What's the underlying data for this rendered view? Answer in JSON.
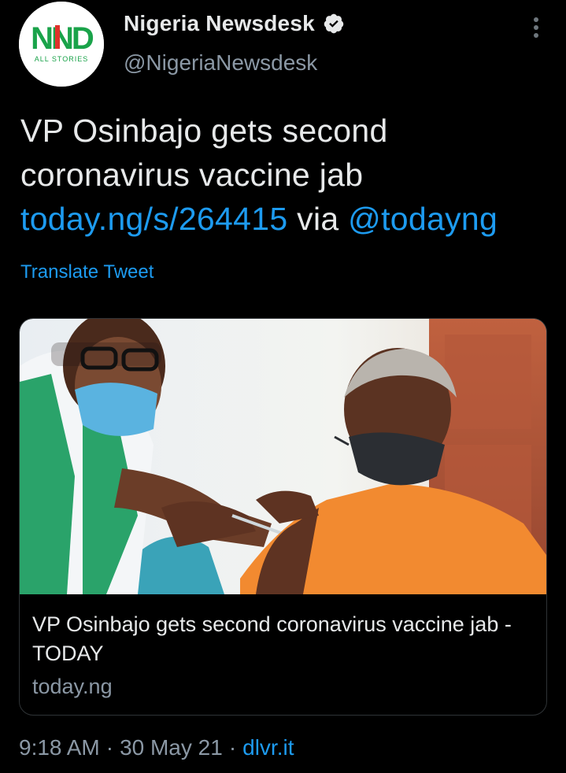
{
  "account": {
    "display_name": "Nigeria Newsdesk",
    "handle": "@NigeriaNewsdesk",
    "avatar_logo_text": "NND",
    "avatar_logo_subtext": "ALL STORIES",
    "verified": true
  },
  "tweet": {
    "text_plain": "VP Osinbajo gets second coronavirus vaccine jab ",
    "link": "today.ng/s/264415",
    "via_word": " via ",
    "mention": "@todayng",
    "translate_label": "Translate Tweet"
  },
  "card": {
    "title": "VP Osinbajo gets second coronavirus vaccine jab - TODAY",
    "domain": "today.ng",
    "image_subject": "health worker administering vaccine to man in orange shirt"
  },
  "meta": {
    "time": "9:18 AM",
    "separator": "·",
    "date": "30 May 21",
    "source": "dlvr.it"
  },
  "colors": {
    "background": "#000000",
    "text": "#e7e9ea",
    "secondary": "#8b98a5",
    "link": "#1d9bf0",
    "logo_green": "#1aa34a",
    "logo_red": "#e0312b"
  },
  "icons": {
    "verified": "verified-badge-icon",
    "more": "more-vertical-icon"
  }
}
